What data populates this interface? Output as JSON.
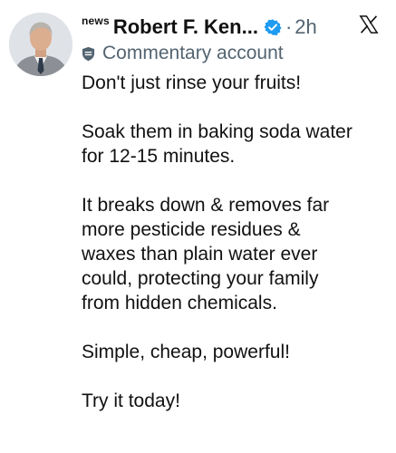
{
  "post": {
    "author_prefix": "news",
    "author_name": "Robert F. Ken...",
    "separator": "·",
    "time": "2h",
    "badge_icon": "verified-badge-icon",
    "badge_color": "#1d9bf0",
    "platform_icon": "x-logo-icon",
    "label_icon": "shield-icon",
    "label": "Commentary account",
    "paragraphs": [
      "Don't just rinse your fruits!",
      "Soak them in baking soda water\nfor 12-15 minutes.",
      "It breaks down & removes far\nmore pesticide residues &\nwaxes than plain water ever\ncould, protecting your family\nfrom hidden chemicals.",
      "Simple, cheap, powerful!",
      "Try it today!"
    ]
  }
}
